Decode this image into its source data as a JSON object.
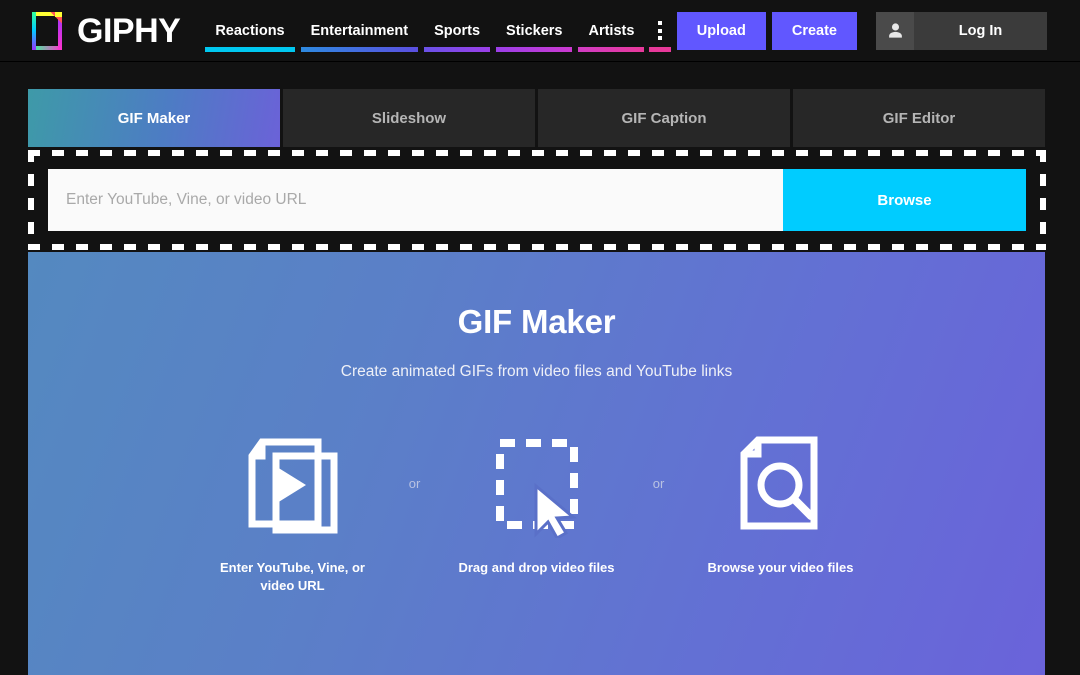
{
  "brand": {
    "name": "GIPHY",
    "logo_icon": "giphy-logo-icon"
  },
  "nav": {
    "items": [
      {
        "label": "Reactions",
        "underline": "#00c8f0"
      },
      {
        "label": "Entertainment",
        "underline": "#3d6ae0"
      },
      {
        "label": "Sports",
        "underline": "#7a46e8"
      },
      {
        "label": "Stickers",
        "underline": "#a83ae0"
      },
      {
        "label": "Artists",
        "underline": "#df3fbe"
      },
      {
        "label": "",
        "underline": "#e8399a"
      }
    ],
    "more_icon": "kebab-menu-icon"
  },
  "actions": {
    "upload_label": "Upload",
    "create_label": "Create",
    "login_label": "Log In",
    "avatar_icon": "user-avatar-icon",
    "purple": "#6157ff",
    "login_bg": "#3b3b3b"
  },
  "tabs": [
    {
      "label": "GIF Maker",
      "active": true
    },
    {
      "label": "Slideshow",
      "active": false
    },
    {
      "label": "GIF Caption",
      "active": false
    },
    {
      "label": "GIF Editor",
      "active": false
    }
  ],
  "dropzone": {
    "input_placeholder": "Enter YouTube, Vine, or video URL",
    "input_value": "",
    "browse_label": "Browse",
    "browse_color": "#00ccff"
  },
  "hero": {
    "title": "GIF Maker",
    "subtitle": "Create animated GIFs from video files and YouTube links",
    "gradient_from": "#5489c0",
    "gradient_to": "#6a63da"
  },
  "options": [
    {
      "icon": "video-pages-play-icon",
      "caption": "Enter YouTube, Vine, or video URL"
    },
    {
      "icon": "dashed-square-cursor-icon",
      "caption": "Drag and drop video files"
    },
    {
      "icon": "document-magnifier-icon",
      "caption": "Browse your video files"
    }
  ],
  "separators": {
    "or": "or"
  }
}
